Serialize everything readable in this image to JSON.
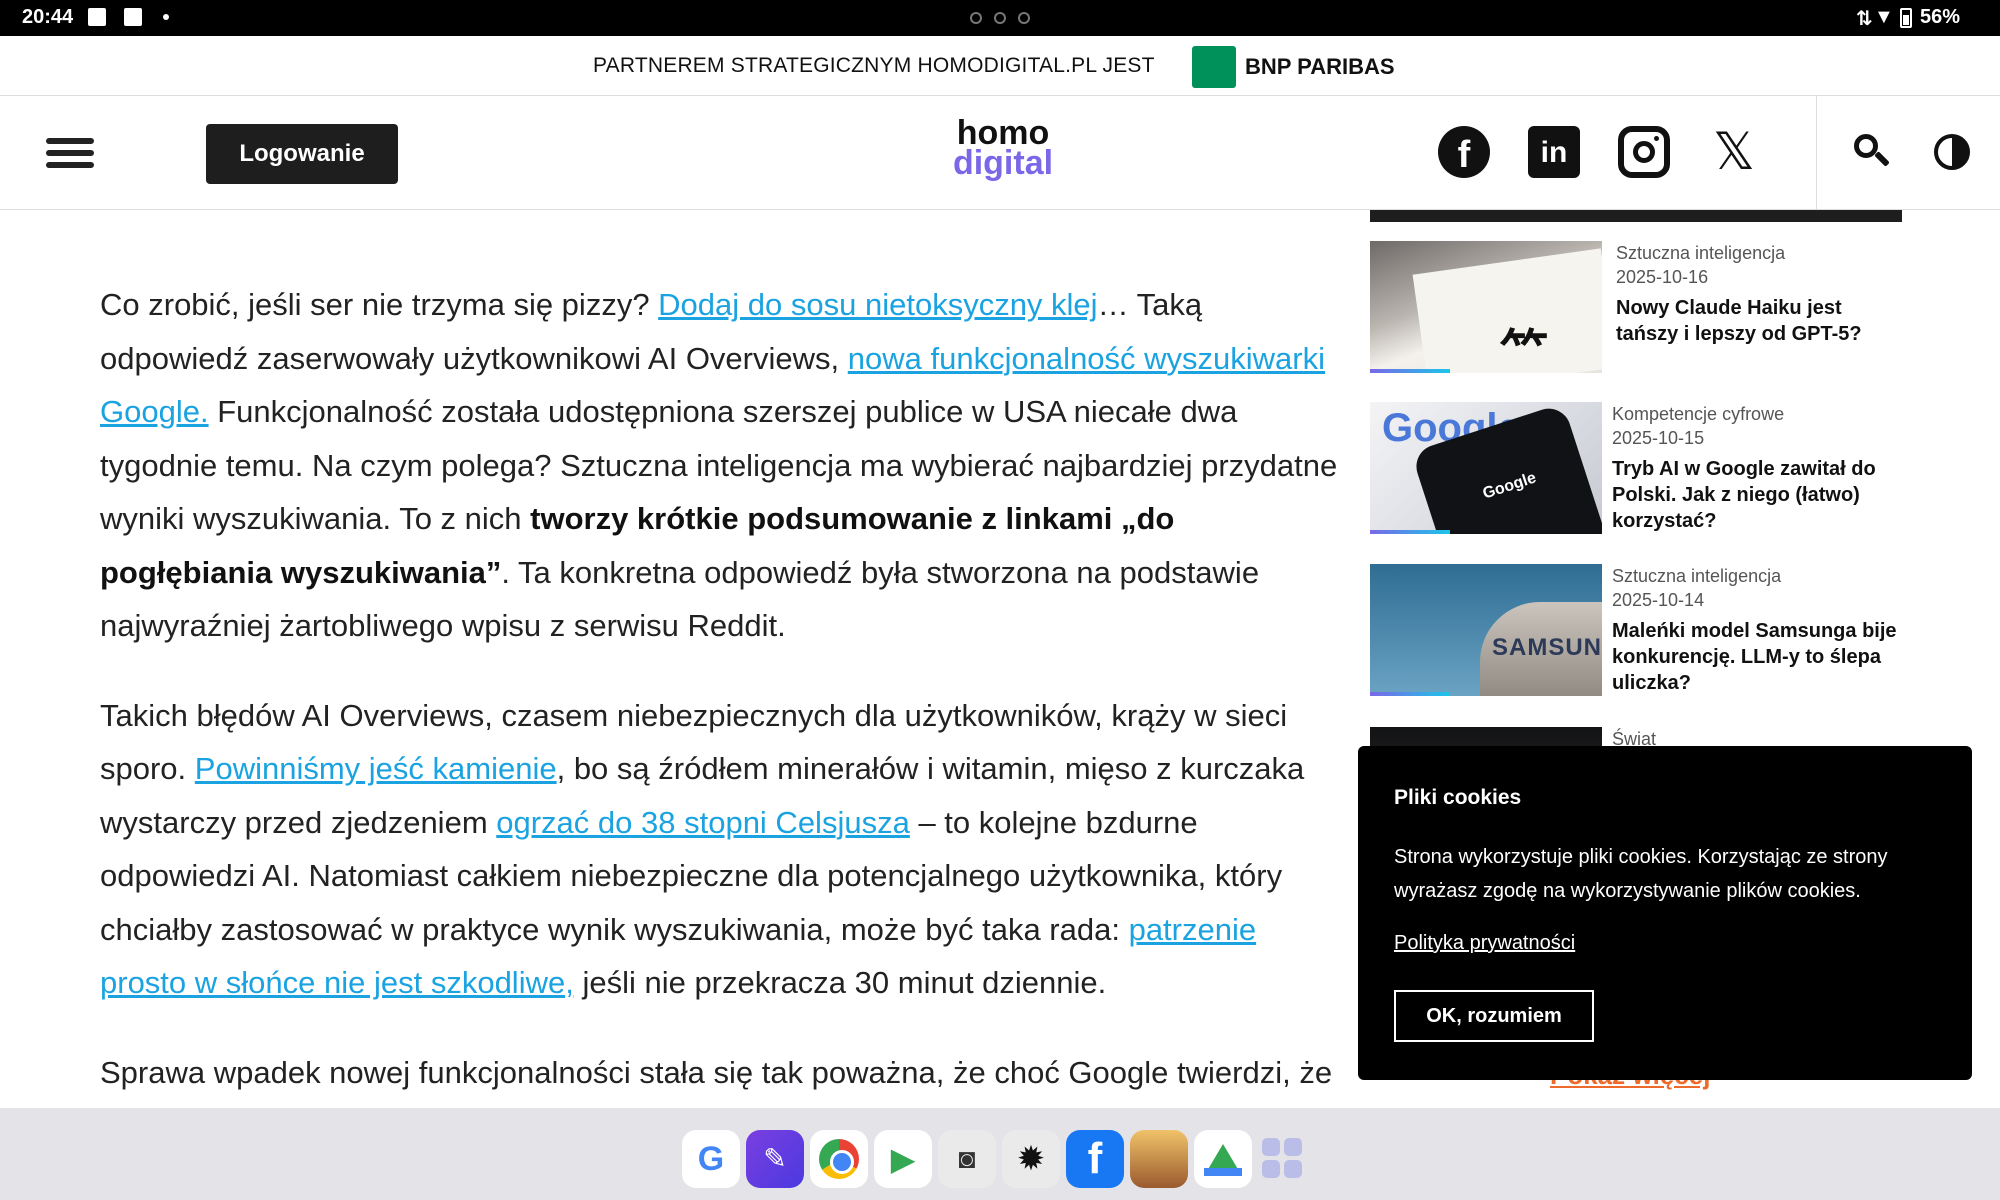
{
  "status_bar": {
    "time": "20:44",
    "battery": "56%"
  },
  "partner": {
    "text": "PARTNEREM STRATEGICZNYM HOMODIGITAL.PL JEST",
    "brand": "BNP PARIBAS"
  },
  "header": {
    "login_label": "Logowanie",
    "logo_top": "homo",
    "logo_bottom": "digital"
  },
  "article": {
    "p1": {
      "t1": "Co zrobić, jeśli ser nie trzyma się pizzy? ",
      "link1": "Dodaj do sosu nietoksyczny klej",
      "t2": "… Taką odpowiedź zaserwowały użytkownikowi AI Overviews, ",
      "link2": "nowa funkcjonalność wyszukiwarki Google.",
      "t3": " Funkcjonalność została udostępniona szerszej publice w USA niecałe dwa tygodnie temu. Na czym polega? Sztuczna inteligencja ma wybierać najbardziej przydatne wyniki wyszukiwania. To z nich ",
      "bold": "tworzy krótkie podsumowanie z linkami „do pogłębiania wyszukiwania”",
      "t4": ". Ta konkretna odpowiedź była stworzona na podstawie najwyraźniej żartobliwego wpisu z serwisu Reddit."
    },
    "p2": {
      "t1": "Takich błędów AI Overviews, czasem niebezpiecznych dla użytkowników, krąży w sieci sporo. ",
      "link1": "Powinniśmy jeść kamienie",
      "t2": ", bo są źródłem minerałów i witamin, mięso z kurczaka wystarczy przed zjedzeniem ",
      "link2": "ogrzać do 38 stopni Celsjusza",
      "t3": " – to kolejne bzdurne odpowiedzi AI. Natomiast całkiem niebezpieczne dla potencjalnego użytkownika, który chciałby zastosować w praktyce wynik wyszukiwania, może być taka rada: ",
      "link3": "patrzenie prosto w słońce nie jest szkodliwe,",
      "t4": " jeśli nie przekracza 30 minut dziennie."
    },
    "p3": {
      "t1": "Sprawa wpadek nowej funkcjonalności stała się tak poważna, że choć Google twierdzi, że"
    }
  },
  "sidebar": {
    "items": [
      {
        "category": "Sztuczna inteligencja",
        "date": "2025-10-16",
        "title": "Nowy Claude Haiku jest tańszy i lepszy od GPT-5?"
      },
      {
        "category": "Kompetencje cyfrowe",
        "date": "2025-10-15",
        "title": "Tryb AI w Google zawitał do Polski. Jak z niego (łatwo) korzystać?"
      },
      {
        "category": "Sztuczna inteligencja",
        "date": "2025-10-14",
        "title": "Maleńki model Samsunga bije konkurencję. LLM-y to ślepa uliczka?"
      },
      {
        "category": "Świat",
        "date": "",
        "title": ""
      }
    ],
    "show_more": "Pokaż więcej",
    "thumb_texts": {
      "google": "Google",
      "phone": "Google",
      "samsung": "SAMSUNG"
    }
  },
  "cookie": {
    "title": "Pliki cookies",
    "text": "Strona wykorzystuje pliki cookies. Korzystając ze strony wyrażasz zgodę na wykorzystywanie plików cookies.",
    "link": "Polityka prywatności",
    "ok_label": "OK, rozumiem"
  },
  "dock": {
    "apps": [
      "google-icon",
      "nova-icon",
      "chrome-icon",
      "play-store-icon",
      "camera-icon",
      "settings-icon",
      "facebook-icon",
      "game-icon",
      "drive-icon",
      "app-drawer-icon"
    ]
  }
}
